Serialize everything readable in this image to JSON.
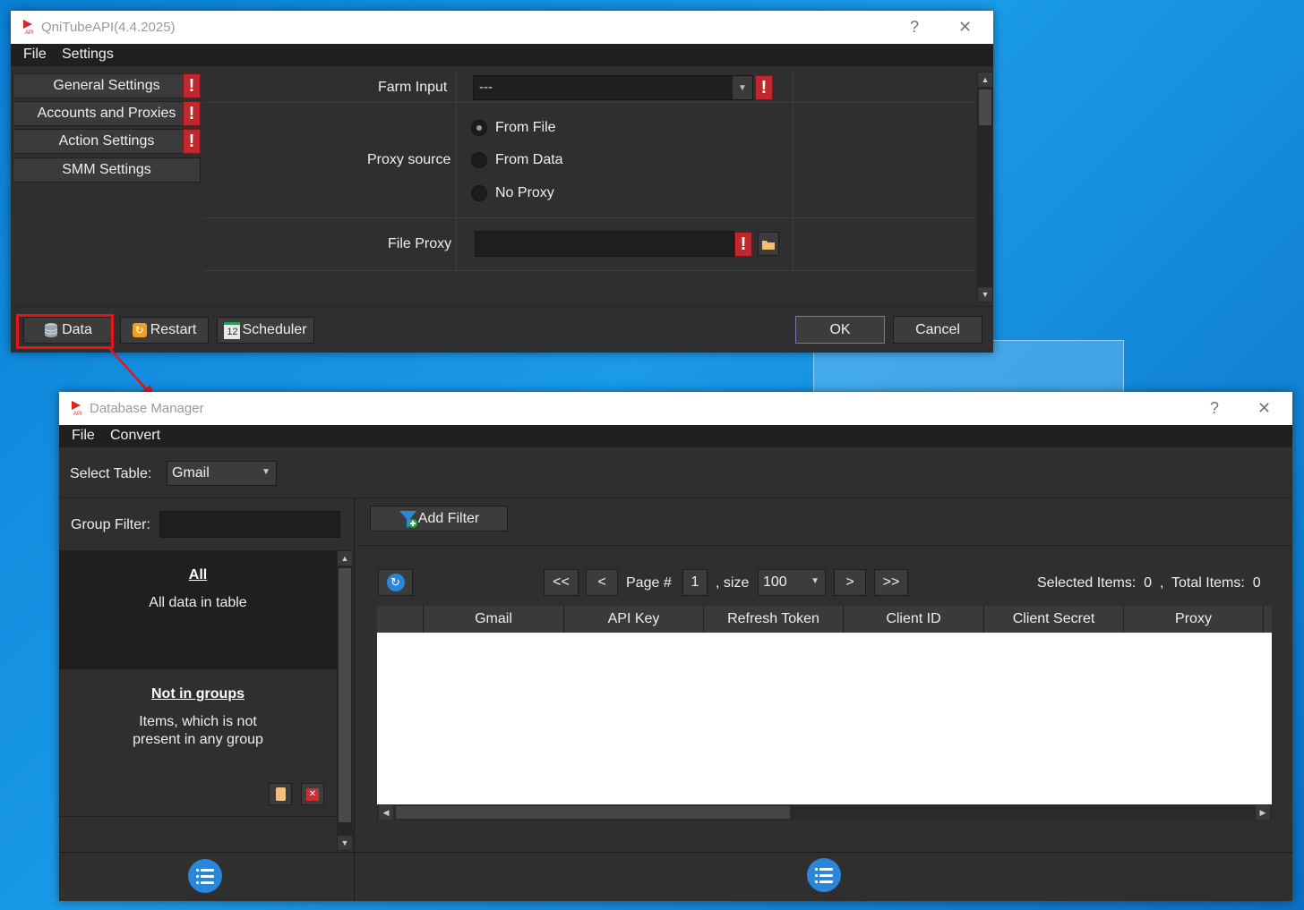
{
  "main_window": {
    "title": "QniTubeAPI(4.4.2025)",
    "help_glyph": "?",
    "close_glyph": "✕",
    "menu": [
      "File",
      "Settings"
    ],
    "nav": [
      {
        "label": "General Settings",
        "warning": true
      },
      {
        "label": "Accounts and Proxies",
        "warning": true
      },
      {
        "label": "Action Settings",
        "warning": true
      },
      {
        "label": "SMM Settings",
        "warning": false
      }
    ],
    "farm_input": {
      "label": "Farm Input",
      "value": "---"
    },
    "proxy_source": {
      "label": "Proxy source",
      "options": [
        "From File",
        "From Data",
        "No Proxy"
      ],
      "selected": "From File"
    },
    "file_proxy": {
      "label": "File Proxy",
      "value": ""
    },
    "bottom_buttons": {
      "data": "Data",
      "restart": "Restart",
      "scheduler": "Scheduler",
      "scheduler_icon_text": "12",
      "ok": "OK",
      "cancel": "Cancel"
    }
  },
  "db_window": {
    "title": "Database Manager",
    "help_glyph": "?",
    "close_glyph": "✕",
    "menu": [
      "File",
      "Convert"
    ],
    "select_table": {
      "label": "Select Table:",
      "value": "Gmail"
    },
    "group_filter": {
      "label": "Group Filter:",
      "value": ""
    },
    "groups": [
      {
        "name": "All",
        "desc": "All data in table"
      },
      {
        "name": "Not in groups",
        "desc": "Items, which is not present in any group"
      }
    ],
    "add_filter": "Add Filter",
    "pager": {
      "first": "<<",
      "prev": "<",
      "page_label": "Page #",
      "page": "1",
      "size_label": ", size",
      "size": "100",
      "next": ">",
      "last": ">>"
    },
    "selected_items": "Selected Items:  0  ,  Total Items:  0",
    "columns": [
      "Gmail",
      "API Key",
      "Refresh Token",
      "Client ID",
      "Client Secret",
      "Proxy"
    ]
  },
  "warning_glyph": "!",
  "colors": {
    "accent_red": "#c2272d",
    "annotation_red": "#e8141b",
    "dark_bg": "#2f2f2f",
    "icon_blue": "#2a86d8"
  }
}
